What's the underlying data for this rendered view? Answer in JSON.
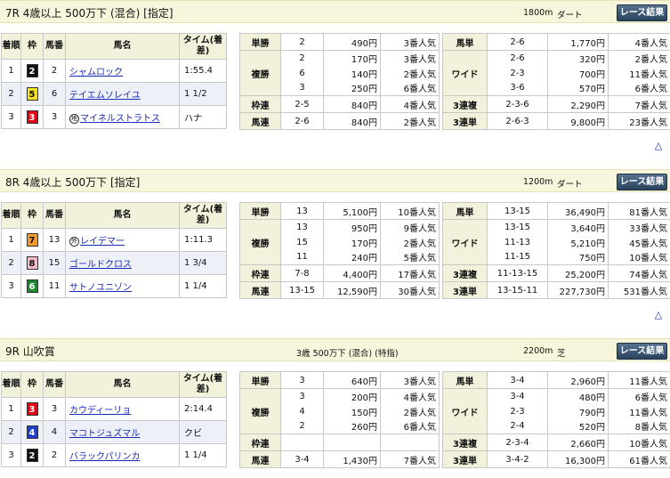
{
  "labels": {
    "result_btn": "レース結果",
    "col_rank": "着順",
    "col_waku": "枠",
    "col_num": "馬番",
    "col_name": "馬名",
    "col_time": "タイム(着差)",
    "tansho": "単勝",
    "fukusho": "複勝",
    "wakuren": "枠連",
    "umaren": "馬連",
    "umatan": "馬単",
    "wide": "ワイド",
    "sanrenpuku": "3連複",
    "sanrentan": "3連単",
    "up_icon": "△"
  },
  "colors": {
    "header_bg": "#f7f6dd",
    "label_bg": "#f2f1db",
    "link": "#1a2bb5",
    "button": "#3a5573"
  },
  "races": [
    {
      "title": "7R 4歳以上 500万下 (混合) [指定]",
      "conditions": "",
      "distance": "1800m",
      "surface": "ダート",
      "results": [
        {
          "rank": "1",
          "waku": "2",
          "waku_bg": "#111111",
          "waku_fg": "#ffffff",
          "num": "2",
          "name": "シャムロック",
          "mark": "",
          "time": "1:55.4"
        },
        {
          "rank": "2",
          "waku": "5",
          "waku_bg": "#f5e21a",
          "waku_fg": "#111111",
          "num": "6",
          "name": "テイエムソレイユ",
          "mark": "",
          "time": "1 1/2"
        },
        {
          "rank": "3",
          "waku": "3",
          "waku_bg": "#e60012",
          "waku_fg": "#ffffff",
          "num": "3",
          "name": "マイネルストラトス",
          "mark": "地",
          "time": "ハナ"
        }
      ],
      "payouts": {
        "tansho": {
          "combo": "2",
          "amount": "490円",
          "pop": "3番人気"
        },
        "fukusho": [
          {
            "combo": "2",
            "amount": "170円",
            "pop": "3番人気"
          },
          {
            "combo": "6",
            "amount": "140円",
            "pop": "2番人気"
          },
          {
            "combo": "3",
            "amount": "250円",
            "pop": "6番人気"
          }
        ],
        "wakuren": {
          "combo": "2-5",
          "amount": "840円",
          "pop": "4番人気"
        },
        "umaren": {
          "combo": "2-6",
          "amount": "840円",
          "pop": "2番人気"
        },
        "umatan": {
          "combo": "2-6",
          "amount": "1,770円",
          "pop": "4番人気"
        },
        "wide": [
          {
            "combo": "2-6",
            "amount": "320円",
            "pop": "2番人気"
          },
          {
            "combo": "2-3",
            "amount": "700円",
            "pop": "11番人気"
          },
          {
            "combo": "3-6",
            "amount": "570円",
            "pop": "6番人気"
          }
        ],
        "sanrenpuku": {
          "combo": "2-3-6",
          "amount": "2,290円",
          "pop": "7番人気"
        },
        "sanrentan": {
          "combo": "2-6-3",
          "amount": "9,800円",
          "pop": "23番人気"
        }
      }
    },
    {
      "title": "8R 4歳以上 500万下 [指定]",
      "conditions": "",
      "distance": "1200m",
      "surface": "ダート",
      "results": [
        {
          "rank": "1",
          "waku": "7",
          "waku_bg": "#f39a2c",
          "waku_fg": "#111111",
          "num": "13",
          "name": "レイデマー",
          "mark": "外",
          "time": "1:11.3"
        },
        {
          "rank": "2",
          "waku": "8",
          "waku_bg": "#f7b8c8",
          "waku_fg": "#111111",
          "num": "15",
          "name": "ゴールドクロス",
          "mark": "",
          "time": "1 3/4"
        },
        {
          "rank": "3",
          "waku": "6",
          "waku_bg": "#1a8a2e",
          "waku_fg": "#ffffff",
          "num": "11",
          "name": "サトノユニゾン",
          "mark": "",
          "time": "1 1/4"
        }
      ],
      "payouts": {
        "tansho": {
          "combo": "13",
          "amount": "5,100円",
          "pop": "10番人気"
        },
        "fukusho": [
          {
            "combo": "13",
            "amount": "950円",
            "pop": "9番人気"
          },
          {
            "combo": "15",
            "amount": "170円",
            "pop": "2番人気"
          },
          {
            "combo": "11",
            "amount": "240円",
            "pop": "5番人気"
          }
        ],
        "wakuren": {
          "combo": "7-8",
          "amount": "4,400円",
          "pop": "17番人気"
        },
        "umaren": {
          "combo": "13-15",
          "amount": "12,590円",
          "pop": "30番人気"
        },
        "umatan": {
          "combo": "13-15",
          "amount": "36,490円",
          "pop": "81番人気"
        },
        "wide": [
          {
            "combo": "13-15",
            "amount": "3,640円",
            "pop": "33番人気"
          },
          {
            "combo": "11-13",
            "amount": "5,210円",
            "pop": "45番人気"
          },
          {
            "combo": "11-15",
            "amount": "750円",
            "pop": "10番人気"
          }
        ],
        "sanrenpuku": {
          "combo": "11-13-15",
          "amount": "25,200円",
          "pop": "74番人気"
        },
        "sanrentan": {
          "combo": "13-15-11",
          "amount": "227,730円",
          "pop": "531番人気"
        }
      }
    },
    {
      "title": "9R 山吹賞",
      "conditions": "3歳 500万下 (混合) (特指)",
      "distance": "2200m",
      "surface": "芝",
      "results": [
        {
          "rank": "1",
          "waku": "3",
          "waku_bg": "#e60012",
          "waku_fg": "#ffffff",
          "num": "3",
          "name": "カウディーリョ",
          "mark": "",
          "time": "2:14.4"
        },
        {
          "rank": "2",
          "waku": "4",
          "waku_bg": "#1e3ed6",
          "waku_fg": "#ffffff",
          "num": "4",
          "name": "マコトジュズマル",
          "mark": "",
          "time": "クビ"
        },
        {
          "rank": "3",
          "waku": "2",
          "waku_bg": "#111111",
          "waku_fg": "#ffffff",
          "num": "2",
          "name": "バラックパリンカ",
          "mark": "",
          "time": "1 1/4"
        }
      ],
      "payouts": {
        "tansho": {
          "combo": "3",
          "amount": "640円",
          "pop": "3番人気"
        },
        "fukusho": [
          {
            "combo": "3",
            "amount": "200円",
            "pop": "4番人気"
          },
          {
            "combo": "4",
            "amount": "150円",
            "pop": "2番人気"
          },
          {
            "combo": "2",
            "amount": "260円",
            "pop": "6番人気"
          }
        ],
        "wakuren": {
          "combo": "",
          "amount": "",
          "pop": ""
        },
        "umaren": {
          "combo": "3-4",
          "amount": "1,430円",
          "pop": "7番人気"
        },
        "umatan": {
          "combo": "3-4",
          "amount": "2,960円",
          "pop": "11番人気"
        },
        "wide": [
          {
            "combo": "3-4",
            "amount": "480円",
            "pop": "6番人気"
          },
          {
            "combo": "2-3",
            "amount": "790円",
            "pop": "11番人気"
          },
          {
            "combo": "2-4",
            "amount": "520円",
            "pop": "8番人気"
          }
        ],
        "sanrenpuku": {
          "combo": "2-3-4",
          "amount": "2,660円",
          "pop": "10番人気"
        },
        "sanrentan": {
          "combo": "3-4-2",
          "amount": "16,300円",
          "pop": "61番人気"
        }
      }
    }
  ]
}
